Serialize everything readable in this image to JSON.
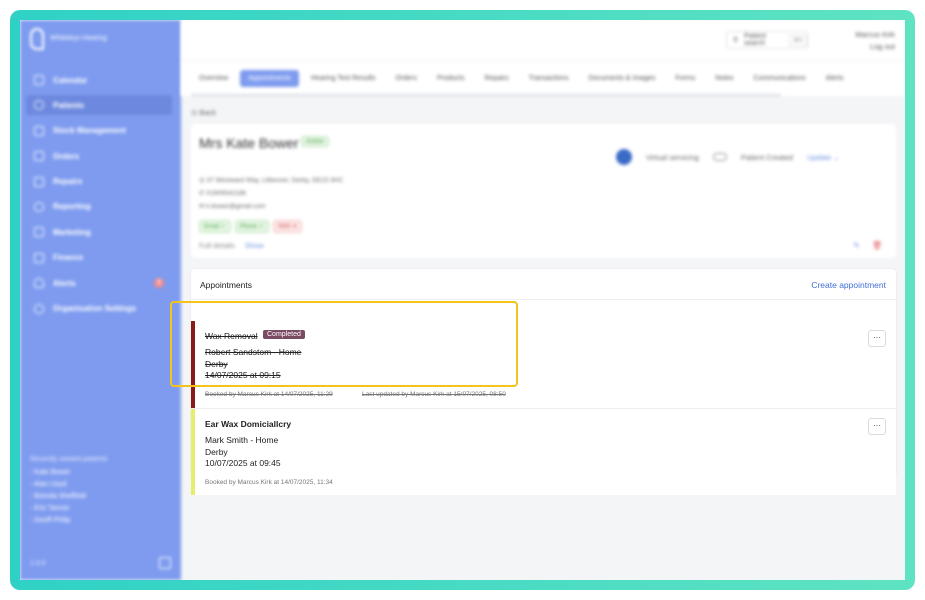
{
  "colors": {
    "frame": "#3fd8c4",
    "sidebar": "#7e9bef",
    "accent": "#3f6fd6",
    "completed_bar": "#8b1a1a",
    "pending_bar": "#e6ef6d",
    "highlight": "#f4c41b"
  },
  "sidebar": {
    "logo_text": "Whiteleys Hearing",
    "items": [
      {
        "label": "Calendar",
        "icon": "calendar-icon"
      },
      {
        "label": "Patients",
        "icon": "user-icon"
      },
      {
        "label": "Stock Management",
        "icon": "box-icon"
      },
      {
        "label": "Orders",
        "icon": "orders-icon"
      },
      {
        "label": "Repairs",
        "icon": "wrench-icon"
      },
      {
        "label": "Reporting",
        "icon": "clock-icon"
      },
      {
        "label": "Marketing",
        "icon": "mail-icon"
      },
      {
        "label": "Finance",
        "icon": "card-icon"
      },
      {
        "label": "Alerts",
        "icon": "bell-icon",
        "badge": "2"
      },
      {
        "label": "Organisation Settings",
        "icon": "gear-icon"
      }
    ],
    "recent_title": "Recently viewed patients",
    "recent": [
      "- Kate Bower",
      "- Alan Lloyd",
      "- Brenda Sheffield",
      "- Eric Tanner",
      "- Geoff Philip"
    ],
    "version": "1.0.0"
  },
  "topbar": {
    "search_label": "Patient search",
    "search_kbd": "⌘K",
    "user_name": "Marcus Kirk",
    "logout": "Log out"
  },
  "tabs": [
    "Overview",
    "Appointments",
    "Hearing Test Results",
    "Orders",
    "Products",
    "Repairs",
    "Transactions",
    "Documents & Images",
    "Forms",
    "Notes",
    "Communications",
    "Alerts"
  ],
  "back_label": "Back",
  "patient": {
    "name": "Mrs Kate Bower",
    "status": "Active",
    "address": "37 Westward Way, Littleover, Derby, DE23 3HC",
    "phone": "01909542186",
    "email": "k.bower@gmail.com",
    "chips": [
      "Email ✓",
      "Phone ✓",
      "SMS ✕"
    ],
    "virtual_servicing": "Virtual servicing",
    "patient_created": "Patient Created",
    "update": "Update",
    "full_details": "Full details",
    "show": "Show"
  },
  "appointments": {
    "title": "Appointments",
    "create_label": "Create appointment",
    "items": [
      {
        "title": "Wax Removal",
        "status": "Completed",
        "clinician": "Robert Sandstom - Home",
        "location": "Derby",
        "datetime": "14/07/2025 at 09:15",
        "booked": "Booked by Marcus Kirk at 14/07/2025, 11:29",
        "updated": "Last updated by Marcus Kirk at 15/07/2025, 08:50"
      },
      {
        "title": "Ear Wax Domiciallcry",
        "clinician": "Mark Smith - Home",
        "location": "Derby",
        "datetime": "10/07/2025 at 09:45",
        "booked": "Booked by Marcus Kirk at 14/07/2025, 11:34"
      }
    ],
    "more_label": "···"
  }
}
